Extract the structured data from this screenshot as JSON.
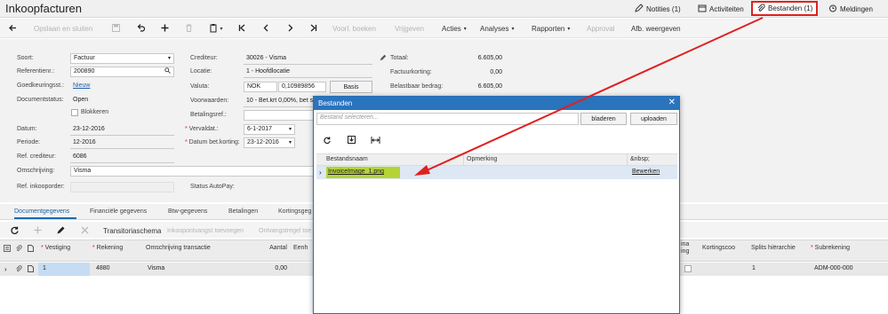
{
  "header": {
    "title": "Inkoopfacturen",
    "notes": "Notities (1)",
    "activities": "Activiteiten",
    "files": "Bestanden (1)",
    "notifications": "Meldingen"
  },
  "toolbar": {
    "save_close": "Opslaan en sluiten",
    "preview": "Voorl. boeken",
    "release": "Vrijgeven",
    "actions": "Acties",
    "analyses": "Analyses",
    "reports": "Rapporten",
    "approval": "Approval",
    "image_view": "Afb. weergeven"
  },
  "form": {
    "type_label": "Soort:",
    "type_value": "Factuur",
    "ref_label": "Referentienr.:",
    "ref_value": "200890",
    "approval_label": "Goedkeuringsst.:",
    "approval_value": "Nieuw",
    "docstatus_label": "Documentstatus:",
    "docstatus_value": "Open",
    "blocked_label": "Blokkeren",
    "date_label": "Datum:",
    "date_value": "23-12-2016",
    "period_label": "Periode:",
    "period_value": "12-2016",
    "refcred_label": "Ref. crediteur:",
    "refcred_value": "6086",
    "desc_label": "Omschrijving:",
    "desc_value": "Visma",
    "po_label": "Ref. inkooporder:",
    "creditor_label": "Crediteur:",
    "creditor_value": "30026 - Visma",
    "location_label": "Locatie:",
    "location_value": "1 - Hoofdlocatie",
    "currency_label": "Valuta:",
    "currency_code": "NOK",
    "currency_rate": "0,10989856",
    "currency_btn": "Basis",
    "terms_label": "Voorwaarden:",
    "terms_value": "10 - Bet.krt 0,00%, bet s",
    "payref_label": "Betalingsref.:",
    "due_label": "Vervaldat.:",
    "due_value": "6-1-2017",
    "discdate_label": "Datum bet.korting:",
    "discdate_value": "23-12-2016",
    "autopay_label": "Status AutoPay:",
    "total_label": "Totaal:",
    "total_value": "6.605,00",
    "invdisc_label": "Factuurkorting:",
    "invdisc_value": "0,00",
    "taxable_label": "Belastbaar bedrag:",
    "taxable_value": "6.605,00"
  },
  "tabs": [
    "Documentgegevens",
    "Financiële gegevens",
    "Btw-gegevens",
    "Betalingen",
    "Kortingsgeg"
  ],
  "grid": {
    "toolbar": {
      "transition": "Transitoriaschema",
      "receipt_add": "Inkoopontvangst toevoegen",
      "receipt_line_add": "Ontvangstregel toe"
    },
    "columns": {
      "branch": "Vestiging",
      "account": "Rekening",
      "description": "Omschrijving transactie",
      "qty": "Aantal",
      "unit": "Eenh",
      "pa_part1": "ina",
      "pa_part2": "ing",
      "discount": "Kortingscoo",
      "splits": "Splits hiërarchie",
      "subaccount": "Subrekening"
    },
    "row": {
      "branch": "1",
      "account": "4880",
      "description": "Visma",
      "qty": "0,00",
      "splits": "1",
      "subaccount": "ADM-000-000"
    }
  },
  "dialog": {
    "title": "Bestanden",
    "placeholder": "Bestand selecteren...",
    "browse": "bladeren",
    "upload": "uploaden",
    "col_name": "Bestandsnaam",
    "col_comment": "Opmerking",
    "col_extra": "&nbsp;",
    "file_name": "InvoiceImage_1.png",
    "edit": "Bewerken"
  },
  "colors": {
    "accent": "#2a73bd",
    "highlight": "#b5d335",
    "annotation": "#e02020"
  }
}
